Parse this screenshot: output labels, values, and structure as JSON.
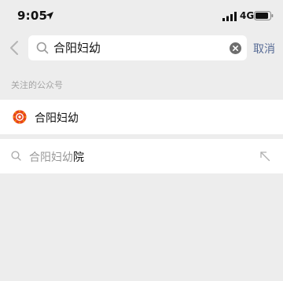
{
  "status_bar": {
    "time": "9:05",
    "network": "4G",
    "icons": [
      "location-arrow-icon",
      "signal-icon",
      "battery-icon"
    ]
  },
  "search": {
    "query": "合阳妇幼",
    "cancel_label": "取消",
    "icons": [
      "back-icon",
      "search-icon",
      "clear-icon"
    ]
  },
  "section": {
    "title": "关注的公众号"
  },
  "results": [
    {
      "name": "合阳妇幼",
      "icon": "official-account-logo-icon"
    }
  ],
  "suggestion": {
    "match": "合阳妇幼",
    "rest": "院",
    "icons": [
      "search-icon",
      "fill-query-arrow-icon"
    ]
  },
  "colors": {
    "background": "#ededed",
    "link_blue": "#576b95",
    "secondary_text": "#a4a4a4"
  }
}
